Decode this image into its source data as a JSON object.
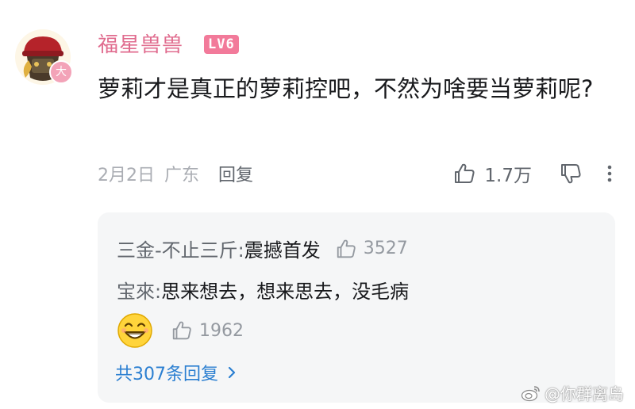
{
  "comment": {
    "username": "福星兽兽",
    "level_badge": "LV6",
    "avatar_badge": "大",
    "text": "萝莉才是真正的萝莉控吧，不然为啥要当萝莉呢?",
    "date": "2月2日",
    "location": "广东",
    "reply_label": "回复",
    "like_count": "1.7万"
  },
  "replies": {
    "items": [
      {
        "author": "三金-不止三斤:",
        "text": " 震撼首发",
        "likes": "3527"
      },
      {
        "author": "宝來:",
        "text": " 思来想去，想来思去，没毛病",
        "likes": "1962"
      }
    ],
    "view_more": "共307条回复"
  },
  "watermark": "@你群离岛",
  "colors": {
    "username": "#e06b8e",
    "level_badge_bg": "#f27a9a",
    "link": "#2b7fd1",
    "muted": "#aaadb3",
    "panel_bg": "#f5f6f7"
  },
  "icons": [
    "thumbs-up-icon",
    "thumbs-down-icon",
    "more-dots-icon",
    "chevron-right-icon",
    "grin-emoji",
    "weibo-logo-icon"
  ]
}
